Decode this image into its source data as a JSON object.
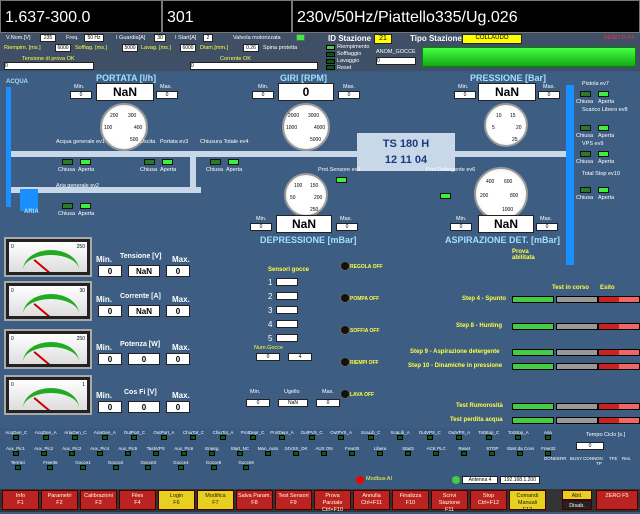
{
  "header": {
    "prog": "1.637-300.0",
    "code": "301",
    "desc": "230v/50Hz/Piattello335/Ug.026"
  },
  "params": {
    "vnom_lbl": "V.Nom.[V]",
    "vnom": "235",
    "freq_lbl": "Freq.",
    "freq": "50 Hz",
    "iguard_lbl": "I Guardia[A]",
    "iguard": "30",
    "istart_lbl": "I Start[A]",
    "istart": "2",
    "riemp_lbl": "Riempim. [ms.]",
    "riemp": "6000",
    "soff_lbl": "Soffiag. [ms.]",
    "soff": "5000",
    "lav_lbl": "Lavag. [ms.]",
    "lav": "6000",
    "diam_lbl": "Diam.[mm.]",
    "diam": "0.26",
    "valvola": "Valvola motorizzata",
    "spina": "Spina protetta",
    "tensione_ok": "Tensione di prova OK",
    "tensione_val": "0",
    "corrente_ok": "Corrente OK",
    "corrente_val": "0"
  },
  "station": {
    "id_lbl": "ID Stazione",
    "id": "21",
    "tipo_lbl": "Tipo Stazione",
    "tipo": "COLLAUDO",
    "reset_lbl": "RESET Pr.F4",
    "opts": [
      "Riempimento",
      "Soffiaggio",
      "Lavaggio",
      "Reset"
    ],
    "anom_lbl": "ANOM_GOCCE",
    "anom_val": "0"
  },
  "portata": {
    "title": "PORTATA [l/h]",
    "min_lbl": "Min.",
    "max_lbl": "Max.",
    "min": "0",
    "max": "0",
    "val": "NaN",
    "ticks": [
      "100",
      "200",
      "300",
      "400",
      "500"
    ]
  },
  "giri": {
    "title": "GIRI [RPM]",
    "min_lbl": "Min.",
    "max_lbl": "Max.",
    "min": "0",
    "max": "0",
    "val": "0",
    "ticks": [
      "1000",
      "2000",
      "3000",
      "4000",
      "5000"
    ]
  },
  "pressione": {
    "title": "PRESSIONE [Bar]",
    "min_lbl": "Min.",
    "max_lbl": "Max.",
    "min": "0",
    "max": "0",
    "val": "NaN",
    "ticks": [
      "5",
      "10",
      "15",
      "20",
      "25"
    ]
  },
  "depressione": {
    "title": "DEPRESSIONE [mBar]",
    "min_lbl": "Min.",
    "max_lbl": "Max.",
    "min": "0",
    "max": "0",
    "val": "NaN",
    "ticks": [
      "50",
      "100",
      "150",
      "200",
      "250"
    ]
  },
  "aspirazione": {
    "title": "ASPIRAZIONE DET. [mBar]",
    "min_lbl": "Min.",
    "max_lbl": "Max.",
    "min": "0",
    "max": "0",
    "val": "NaN",
    "ticks": [
      "200",
      "400",
      "600",
      "800",
      "1000"
    ]
  },
  "circuit": {
    "acqua": "ACQUA",
    "aria": "ARIA",
    "chiusa": "Chiusa",
    "aperta": "Aperta",
    "acqua_gen": "Acqua generale ev1",
    "uscita": "Uscita",
    "portata_ev3": "Portata ev3",
    "chiusura": "Chiusura Totale ev4",
    "aria_gen": "Aria generale ev2",
    "prot_sens": "Prot.Sensore ev5",
    "prot_det": "Prot.Detergente ev6",
    "pistola": "Pistola ev7",
    "scarico": "Scarico Libero ev8",
    "vps": "VPS ev9",
    "total_stop": "Total Stop ev10",
    "ts_line1": "TS 180 H",
    "ts_line2": "12 11 04"
  },
  "meters": [
    {
      "name": "Tensione [V]",
      "max_scale": "250",
      "min": "0",
      "val": "NaN",
      "max": "0"
    },
    {
      "name": "Corrente [A]",
      "max_scale": "30",
      "min": "0",
      "val": "NaN",
      "max": "0"
    },
    {
      "name": "Potenza [W]",
      "max_scale": "250",
      "min": "0",
      "val": "0",
      "max": "0"
    },
    {
      "name": "Cos Fi [V]",
      "max_scale": "1",
      "min": "0",
      "val": "0",
      "max": "0"
    }
  ],
  "meter_labels": {
    "min": "Min.",
    "max": "Max.",
    "zero": "0"
  },
  "gocce": {
    "title": "Sensori gocce",
    "nums": [
      "1",
      "2",
      "3",
      "4",
      "5"
    ],
    "num_lbl": "Num.Gocce",
    "num_val": "0",
    "num_val2": "4"
  },
  "status_leds": [
    "REGOLA OFF",
    "POMPA OFF",
    "SOFFIA OFF",
    "RIEMPI OFF",
    "LAVA OFF"
  ],
  "ugello": {
    "min_lbl": "Min.",
    "lbl": "Ugello",
    "max_lbl": "Max.",
    "min": "0",
    "val": "NaN",
    "max": "0"
  },
  "steps": {
    "col1": "Prova abilitata",
    "col2": "Test in corso",
    "col3": "Esito",
    "rows": [
      "Step 4 - Spunto",
      "Step 8 - Hunting",
      "Step 9 - Aspirazione detergente",
      "Step 10 - Dinamiche in pressione",
      "Test Rumorosità",
      "Test perdita acqua"
    ]
  },
  "io_top": [
    "AcqGen_C",
    "AcqGen_A",
    "AriaGen_C",
    "AriaGen_A",
    "OutPort_C",
    "OutPort_A",
    "ChiuTot_C",
    "ChiuTot_A",
    "ProtDepr_C",
    "ProtDepr_A",
    "OutPVS_C",
    "OutPVS_A",
    "ScaLib_C",
    "ScaLib_A",
    "OutVPS_C",
    "OutVPS_A",
    "TotStop_C",
    "TotStop_A",
    "Aria"
  ],
  "io_mid": [
    "Aux_Pic1",
    "Aux_Pic2",
    "Aux_Pic3",
    "Aux_Pic4",
    "Aux_Pic5",
    "TastiVPS",
    "Aux_Pic6",
    "Emerg",
    "Start_NC",
    "Man_Auto",
    "24VSX_OK",
    "AUX ON",
    "Free30",
    "Libera",
    "Start1",
    "ACK PLC",
    "Reset",
    "STOP",
    "Start da Console",
    "Free32"
  ],
  "io_bot": [
    "Termici",
    "Free36",
    "Gocce1",
    "Gocce2",
    "Gocce3",
    "Gocce4",
    "Gocce5",
    "Gocce6"
  ],
  "tempo": {
    "lbl": "Tempo Ciclo [s.]",
    "val": "0"
  },
  "flags": [
    "DONE",
    "ERR",
    "BUSY",
    "CONN",
    "ON TP",
    "TFE",
    "Res."
  ],
  "modbus": "Modbus AI",
  "antenna": "Antenna 4",
  "ip": "192.168.1.200",
  "fkeys": [
    {
      "t": "Info",
      "k": "F1"
    },
    {
      "t": "Parametri",
      "k": "F2"
    },
    {
      "t": "Calibrazioni",
      "k": "F3"
    },
    {
      "t": "Files",
      "k": "F4"
    },
    {
      "t": "Login",
      "k": "F6"
    },
    {
      "t": "Modifica",
      "k": "F7"
    },
    {
      "t": "Salva Param.",
      "k": "F8"
    },
    {
      "t": "Test Sensori",
      "k": "F9"
    },
    {
      "t": "Prova Parziale",
      "k": "Ctrl+F10"
    },
    {
      "t": "Annulla",
      "k": "Ctrl+F11"
    },
    {
      "t": "Finalizza",
      "k": "F10"
    },
    {
      "t": "Scrivi Stazione",
      "k": "F11"
    },
    {
      "t": "Stop",
      "k": "Ctrl+F12"
    },
    {
      "t": "Comandi Manuali",
      "k": "F12"
    }
  ],
  "abil": "Abil.",
  "disab": "Disab.",
  "zero_f": "ZERO F5",
  "colors": {
    "bg": "#3b5a7d",
    "pipe_v": "#1a8fff",
    "led_on": "#3cf03c"
  }
}
